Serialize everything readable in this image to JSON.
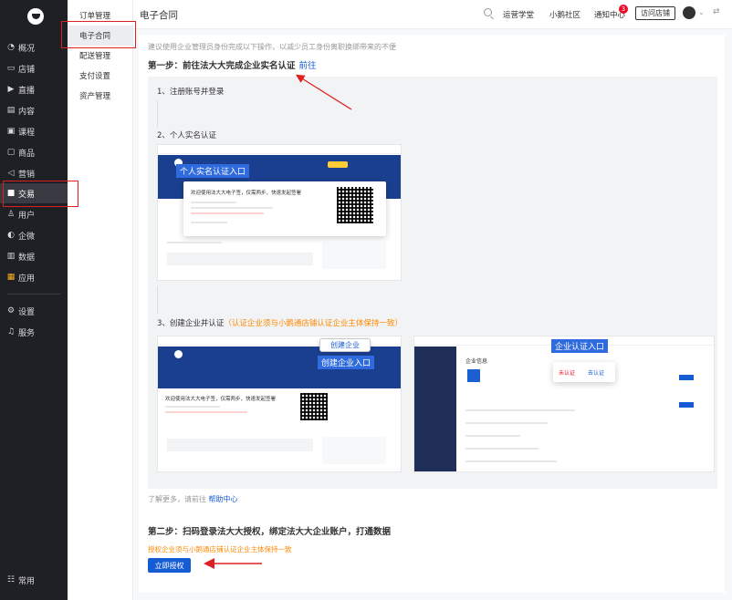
{
  "sidebar": {
    "items": [
      {
        "icon": "◔",
        "label": "概况"
      },
      {
        "icon": "▭",
        "label": "店铺"
      },
      {
        "icon": "▶",
        "label": "直播"
      },
      {
        "icon": "▤",
        "label": "内容"
      },
      {
        "icon": "▣",
        "label": "课程"
      },
      {
        "icon": "▢",
        "label": "商品"
      },
      {
        "icon": "◁",
        "label": "营销"
      },
      {
        "icon": "■",
        "label": "交易"
      },
      {
        "icon": "♙",
        "label": "用户"
      },
      {
        "icon": "◐",
        "label": "企微"
      },
      {
        "icon": "▥",
        "label": "数据"
      },
      {
        "icon": "▦",
        "label": "应用"
      },
      {
        "icon": "⚙",
        "label": "设置"
      },
      {
        "icon": "♫",
        "label": "服务"
      }
    ],
    "footer": {
      "icon": "☷",
      "label": "常用"
    }
  },
  "submenu": {
    "items": [
      "订单管理",
      "电子合同",
      "配送管理",
      "支付设置",
      "资产管理"
    ]
  },
  "topbar": {
    "title": "电子合同",
    "links": [
      "运营学堂",
      "小鹅社区",
      "通知中心"
    ],
    "badge": "3",
    "shop_button": "访问店铺"
  },
  "content": {
    "hint": "建议使用企业管理员身份完成以下操作，以减少员工身份离职换绑带来的不便",
    "step1": {
      "title": "第一步：前往法大大完成企业实名认证",
      "link": "前往"
    },
    "sub1": "1、注册账号并登录",
    "sub2": "2、个人实名认证",
    "sub3": "3、创建企业并认证",
    "sub3_warning": "（认证企业须与小鹅通店铺认证企业主体保持一致）",
    "shot1": {
      "callout": "个人实名认证入口",
      "popup_title": "欢迎使用法大大电子签，仅需两步，快速发起签署"
    },
    "shot2": {
      "callout_white": "创建企业",
      "callout_blue": "创建企业入口",
      "popup_title": "欢迎使用法大大电子签，仅需两步，快速发起签署"
    },
    "shot3": {
      "callout": "企业认证入口",
      "section": "企业信息",
      "status": "未认证",
      "status_link": "去认证"
    },
    "help": {
      "text": "了解更多，请前往",
      "link": "帮助中心"
    },
    "step2": {
      "title": "第二步：扫码登录法大大授权，绑定法大大企业账户，打通数据"
    },
    "step2_note": "授权企业须与小鹅通店铺认证企业主体保持一致",
    "auth_button": "立即授权"
  },
  "colors": {
    "sidebar_bg": "#1f2026",
    "primary": "#155bd4",
    "warning": "#ff8800",
    "annotation_red": "#e02020",
    "fadada_blue": "#1b3f8f"
  }
}
